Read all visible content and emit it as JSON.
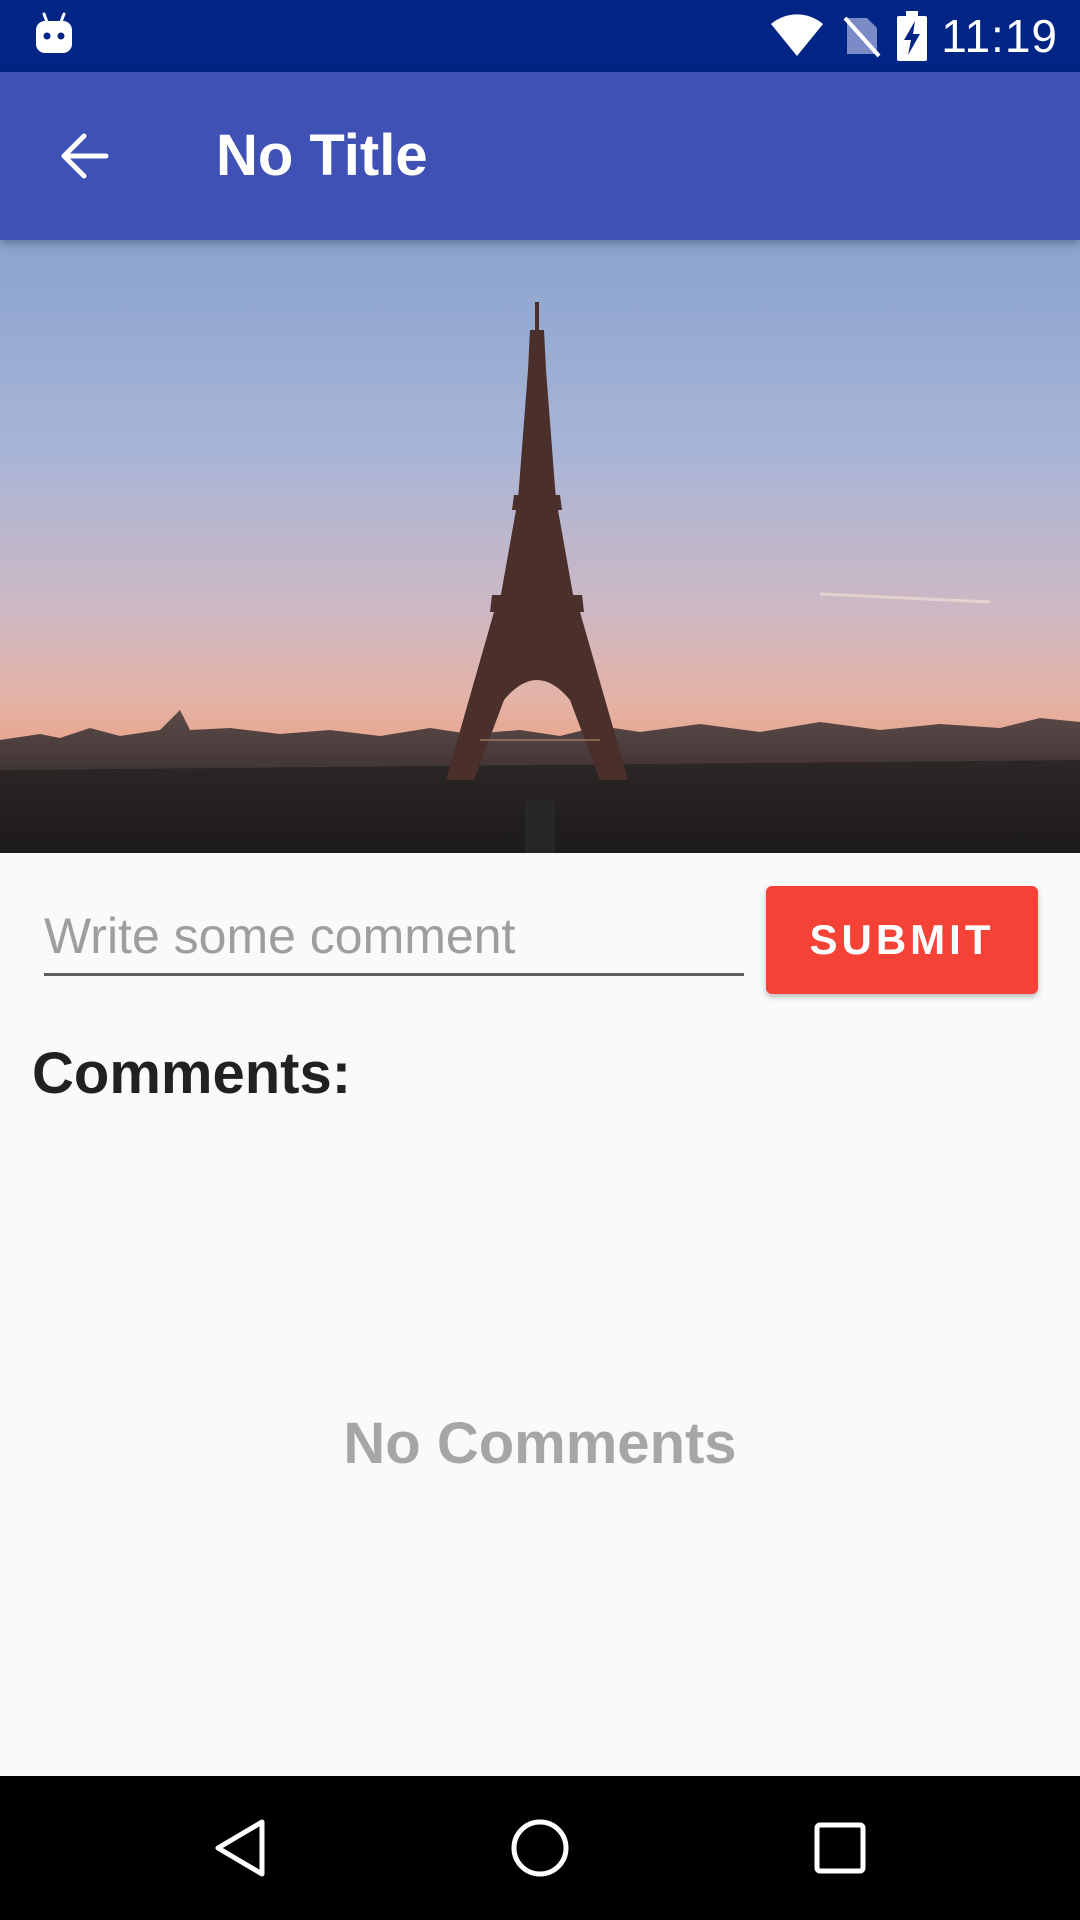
{
  "status_bar": {
    "time": "11:19",
    "icons": [
      "android-notification-icon",
      "wifi-icon",
      "no-sim-icon",
      "battery-charging-icon"
    ]
  },
  "app_bar": {
    "back_icon": "arrow-back-icon",
    "title": "No Title"
  },
  "hero": {
    "image": "eiffel-tower-photo"
  },
  "comment_form": {
    "placeholder": "Write some comment",
    "value": "",
    "submit_label": "SUBMIT"
  },
  "comments": {
    "heading": "Comments:",
    "empty_text": "No Comments"
  },
  "nav_bar": {
    "icons": [
      "back-triangle-icon",
      "home-circle-icon",
      "recents-square-icon"
    ]
  },
  "colors": {
    "status_bar": "#002585",
    "app_bar": "#3f51b5",
    "accent": "#f44336",
    "background": "#fafafa"
  }
}
